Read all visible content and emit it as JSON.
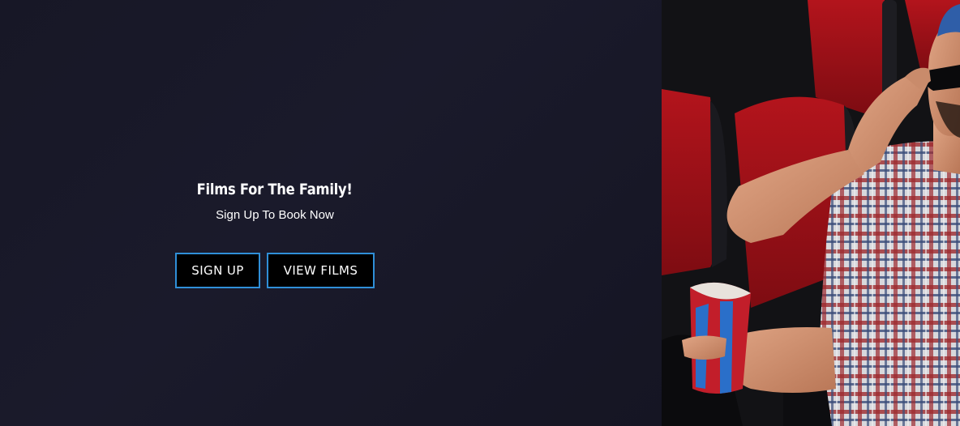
{
  "hero": {
    "headline": "Films For The Family!",
    "subline": "Sign Up To Book Now",
    "buttons": {
      "sign_up_label": "SIGN UP",
      "view_films_label": "VIEW FILMS"
    },
    "colors": {
      "background": "#171726",
      "button_border": "#2f8fd8",
      "button_fill": "#000000",
      "text": "#ffffff"
    }
  },
  "photo": {
    "subject": "man-in-cinema-seat-with-3d-glasses-and-popcorn"
  }
}
